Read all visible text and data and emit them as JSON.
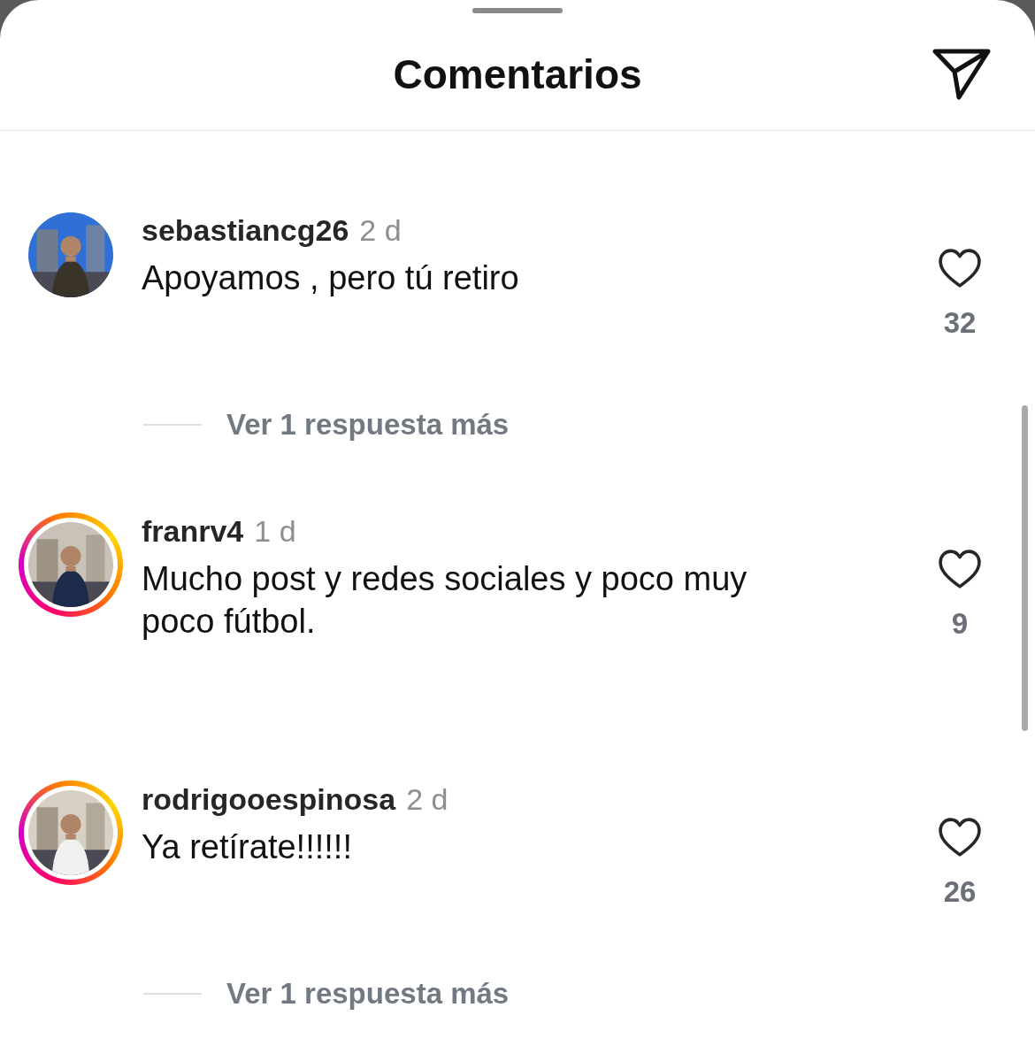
{
  "header": {
    "title": "Comentarios"
  },
  "comments": [
    {
      "username": "sebastiancg26",
      "time": "2 d",
      "text": "Apoyamos , pero tú retiro",
      "likes": "32",
      "story_ring": false,
      "replies": "Ver 1 respuesta más"
    },
    {
      "username": "franrv4",
      "time": "1 d",
      "text": "Mucho post y redes sociales y poco muy poco fútbol.",
      "likes": "9",
      "story_ring": true
    },
    {
      "username": "rodrigooespinosa",
      "time": "2 d",
      "text": "Ya retírate!!!!!!",
      "likes": "26",
      "story_ring": true,
      "replies": "Ver 1 respuesta más"
    }
  ]
}
